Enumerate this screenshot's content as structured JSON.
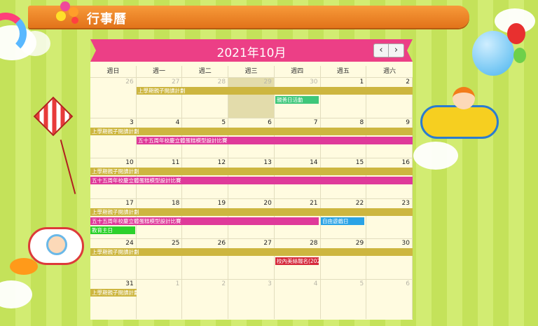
{
  "page": {
    "title": "行事曆",
    "colors": {
      "background": "#c8e660",
      "banner": "#f08a2c",
      "header": "#ec3f86",
      "cell": "#fffbe0",
      "today": "#e3dcab"
    }
  },
  "calendar": {
    "title": "2021年10月",
    "nav_prev": "‹",
    "nav_next": "›",
    "weekdays": [
      "週日",
      "週一",
      "週二",
      "週三",
      "週四",
      "週五",
      "週六"
    ],
    "weeks": [
      {
        "days": [
          {
            "n": "26",
            "other": true
          },
          {
            "n": "27",
            "other": true
          },
          {
            "n": "28",
            "other": true
          },
          {
            "n": "29",
            "other": true,
            "today": true
          },
          {
            "n": "30",
            "other": true
          },
          {
            "n": "1"
          },
          {
            "n": "2"
          }
        ]
      },
      {
        "days": [
          {
            "n": "3"
          },
          {
            "n": "4"
          },
          {
            "n": "5"
          },
          {
            "n": "6"
          },
          {
            "n": "7"
          },
          {
            "n": "8"
          },
          {
            "n": "9"
          }
        ]
      },
      {
        "days": [
          {
            "n": "10"
          },
          {
            "n": "11"
          },
          {
            "n": "12"
          },
          {
            "n": "13"
          },
          {
            "n": "14"
          },
          {
            "n": "15"
          },
          {
            "n": "16"
          }
        ]
      },
      {
        "days": [
          {
            "n": "17"
          },
          {
            "n": "18"
          },
          {
            "n": "19"
          },
          {
            "n": "20"
          },
          {
            "n": "21"
          },
          {
            "n": "22"
          },
          {
            "n": "23"
          }
        ]
      },
      {
        "days": [
          {
            "n": "24"
          },
          {
            "n": "25"
          },
          {
            "n": "26"
          },
          {
            "n": "27"
          },
          {
            "n": "28"
          },
          {
            "n": "29"
          },
          {
            "n": "30"
          }
        ]
      },
      {
        "days": [
          {
            "n": "31"
          },
          {
            "n": "1",
            "other": true
          },
          {
            "n": "2",
            "other": true
          },
          {
            "n": "3",
            "other": true
          },
          {
            "n": "4",
            "other": true
          },
          {
            "n": "5",
            "other": true
          },
          {
            "n": "6",
            "other": true
          }
        ]
      }
    ],
    "events": {
      "reading_w1": "上學期親子閱讀計劃",
      "sports_day": "親善日活動",
      "reading_w2": "上學期親子閱讀計劃",
      "egg_w2": "五十五周年校慶立體蛋糕模型設計比賽",
      "reading_w3": "上學期親子閱讀計劃",
      "egg_w3": "五十五周年校慶立體蛋糕模型設計比賽",
      "reading_w4": "上學期親子閱讀計劃",
      "egg_w4": "五十五周年校慶立體蛋糕模型設計比賽",
      "free_day": "自由遊戲日",
      "education_sun": "教育主日",
      "reading_w5": "上學期親子閱讀計劃",
      "signup": "校內美絲報名(202",
      "reading_w6": "上學期親子閱讀計劃"
    },
    "event_colors": {
      "reading": "#cdb640",
      "competition": "#df3a9a",
      "activity": "#3ec77a",
      "free": "#2aa3e6",
      "education": "#2cd12c",
      "signup": "#d62a3c"
    }
  }
}
